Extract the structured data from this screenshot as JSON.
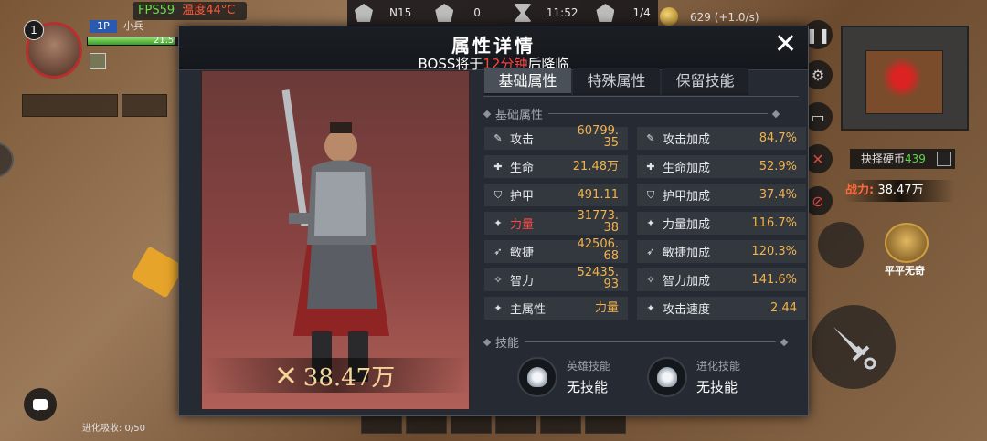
{
  "hud": {
    "fps": "FPS59",
    "temp": "温度44°C",
    "stage": "N15",
    "kills": "0",
    "timer": "11:52",
    "boss_count": "1/4",
    "gold": "629 (+1.0/s)"
  },
  "player": {
    "level": "1",
    "tag": "1P",
    "name": "小兵",
    "hp": "21.5"
  },
  "left": {
    "evolve_text": "进化吸收: 0/50"
  },
  "right": {
    "coin_label": "抉择硬币",
    "coin_value": "439",
    "power_label": "战力:",
    "power_value": "38.47万",
    "player2_name": "平平无奇"
  },
  "modal": {
    "title": "属性详情",
    "boss_prefix": "BOSS将于",
    "boss_time": "12分钟",
    "boss_suffix": "后降临",
    "hero_power": "38.47万",
    "tabs": [
      "基础属性",
      "特殊属性",
      "保留技能"
    ],
    "section_basic": "基础属性",
    "section_skill": "技能",
    "attributes": [
      {
        "name": "攻击",
        "value": "60799.35"
      },
      {
        "name": "攻击加成",
        "value": "84.7%"
      },
      {
        "name": "生命",
        "value": "21.48万"
      },
      {
        "name": "生命加成",
        "value": "52.9%"
      },
      {
        "name": "护甲",
        "value": "491.11"
      },
      {
        "name": "护甲加成",
        "value": "37.4%"
      },
      {
        "name": "力量",
        "value": "31773.38"
      },
      {
        "name": "力量加成",
        "value": "116.7%"
      },
      {
        "name": "敏捷",
        "value": "42506.68"
      },
      {
        "name": "敏捷加成",
        "value": "120.3%"
      },
      {
        "name": "智力",
        "value": "52435.93"
      },
      {
        "name": "智力加成",
        "value": "141.6%"
      },
      {
        "name": "主属性",
        "value": "力量"
      },
      {
        "name": "攻击速度",
        "value": "2.44"
      }
    ],
    "skills": [
      {
        "caption": "英雄技能",
        "value": "无技能"
      },
      {
        "caption": "进化技能",
        "value": "无技能"
      }
    ]
  }
}
